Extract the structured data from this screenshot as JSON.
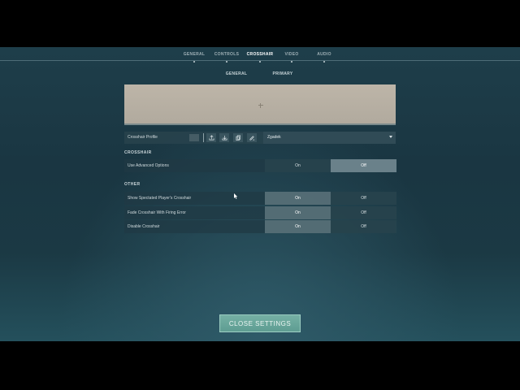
{
  "main_tabs": [
    {
      "label": "GENERAL",
      "active": false
    },
    {
      "label": "CONTROLS",
      "active": false
    },
    {
      "label": "CROSSHAIR",
      "active": true
    },
    {
      "label": "VIDEO",
      "active": false
    },
    {
      "label": "AUDIO",
      "active": false
    }
  ],
  "sub_tabs": [
    {
      "label": "GENERAL",
      "active": true
    },
    {
      "label": "PRIMARY",
      "active": false
    }
  ],
  "profile": {
    "label": "Crosshair Profile",
    "selected": "Zgadek",
    "buttons": [
      "import-icon",
      "download-icon",
      "copy-icon",
      "rename-icon"
    ]
  },
  "sections": {
    "crosshair": {
      "title": "CROSSHAIR",
      "rows": [
        {
          "label": "Use Advanced Options",
          "on": "On",
          "off": "Off",
          "value": "Off"
        }
      ]
    },
    "other": {
      "title": "OTHER",
      "rows": [
        {
          "label": "Show Spectated Player's Crosshair",
          "on": "On",
          "off": "Off",
          "value": "On"
        },
        {
          "label": "Fade Crosshair With Firing Error",
          "on": "On",
          "off": "Off",
          "value": "On"
        },
        {
          "label": "Disable Crosshair",
          "on": "On",
          "off": "Off",
          "value": "On"
        }
      ]
    }
  },
  "close_button": "CLOSE SETTINGS",
  "colors": {
    "accent": "#6aa89c",
    "background": "#1c3a45"
  }
}
